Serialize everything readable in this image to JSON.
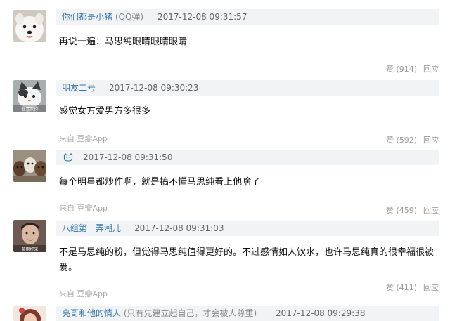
{
  "comments": [
    {
      "author": "你们都是小猪",
      "author_suffix": "(QQ弹)",
      "time": "2017-12-08 09:31:57",
      "content": "再说一遍：马思纯眼睛眼睛眼睛",
      "source": "",
      "vote_label": "赞",
      "vote_count": "(914)",
      "reply_label": "回应",
      "avatar": "white-dog-avatar"
    },
    {
      "author": "朋友二号",
      "time": "2017-12-08 09:30:23",
      "content": "感觉女方爱男方多很多",
      "source": "来自 豆瓣App",
      "vote_label": "赞",
      "vote_count": "(592)",
      "reply_label": "回应",
      "avatar": "cat-avatar",
      "avatar_caption": "我喜欢你"
    },
    {
      "author_icon": "cat-face-icon",
      "time": "2017-12-08 09:31:50",
      "content": "每个明星都炒作啊，就是搞不懂马思纯看上他啥了",
      "source": "来自 豆瓣App",
      "vote_label": "赞",
      "vote_count": "(459)",
      "reply_label": "回应",
      "avatar": "dogs-group-avatar"
    },
    {
      "author": "八组第一弄潮儿",
      "time": "2017-12-08 09:31:03",
      "content": "不是马思纯的粉，但觉得马思纯值得更好的。不过感情如人饮水，也许马思纯真的很幸福很被爱。",
      "source": "来自 豆瓣App",
      "vote_label": "赞",
      "vote_count": "(411)",
      "reply_label": "回应",
      "avatar": "man-photo-avatar",
      "avatar_caption": "莫雨打采"
    },
    {
      "author": "亮哥和他的情人",
      "author_suffix": "(只有先建立起自己，才会被人尊重)",
      "time": "2017-12-08 09:29:38",
      "avatar": "woman-photo-avatar"
    }
  ],
  "colors": {
    "author_link": "#3377aa",
    "meta_bar_bg": "#f2f3f5",
    "muted_text": "#999999",
    "source_text": "#aaaaaa"
  }
}
